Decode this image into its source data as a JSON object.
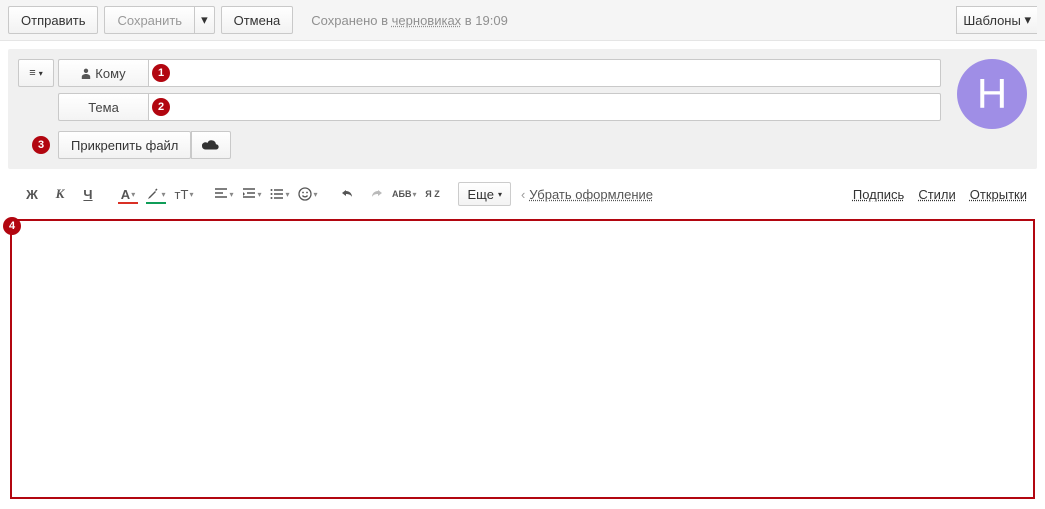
{
  "toolbar": {
    "send": "Отправить",
    "save": "Сохранить",
    "cancel": "Отмена",
    "templates": "Шаблоны",
    "status_prefix": "Сохранено в ",
    "status_link": "черновиках",
    "status_suffix": " в 19:09"
  },
  "fields": {
    "to_label": "Кому",
    "subject_label": "Тема"
  },
  "attach": {
    "label": "Прикрепить файл"
  },
  "avatar": {
    "letter": "Н"
  },
  "format": {
    "bold": "Ж",
    "italic": "К",
    "underline": "Ч",
    "fontcolor": "А",
    "bgcolor_icon": "bgcolor",
    "fontsize": "тТ",
    "spellcheck": "АБВ",
    "translit": "Я Z",
    "more": "Еще",
    "clear": "Убрать оформление"
  },
  "rightlinks": {
    "signature": "Подпись",
    "styles": "Стили",
    "cards": "Открытки"
  },
  "annotations": [
    "1",
    "2",
    "3",
    "4"
  ]
}
